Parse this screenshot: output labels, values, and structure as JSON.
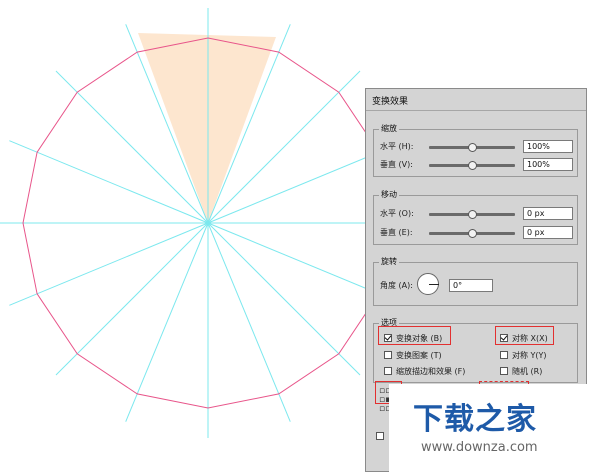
{
  "colors": {
    "guides": "#7ce8ee",
    "polygon": "#e8558a",
    "segment_fill": "#fde6cf",
    "panel_bg": "#d4d4d4",
    "highlight": "#e23030",
    "watermark_blue": "#1e5aa8"
  },
  "dialog": {
    "title": "变换效果",
    "scale": {
      "title": "缩放",
      "horizontal_label": "水平 (H):",
      "horizontal_value": "100%",
      "horizontal_slider_fraction": 0.5,
      "vertical_label": "垂直 (V):",
      "vertical_value": "100%",
      "vertical_slider_fraction": 0.5
    },
    "move": {
      "title": "移动",
      "horizontal_label": "水平 (O):",
      "horizontal_value": "0 px",
      "horizontal_slider_fraction": 0.5,
      "vertical_label": "垂直 (E):",
      "vertical_value": "0 px",
      "vertical_slider_fraction": 0.5
    },
    "rotate": {
      "title": "旋转",
      "angle_label": "角度 (A):",
      "angle_value": "0°"
    },
    "options": {
      "title": "选项",
      "transform_objects": {
        "label": "变换对象 (B)",
        "checked": true
      },
      "transform_patterns": {
        "label": "变换图案 (T)",
        "checked": false
      },
      "scale_strokes": {
        "label": "缩放描边和效果 (F)",
        "checked": false
      },
      "reflect_x": {
        "label": "对称 X(X)",
        "checked": true
      },
      "reflect_y": {
        "label": "对称 Y(Y)",
        "checked": false
      },
      "random": {
        "label": "随机 (R)",
        "checked": false
      }
    },
    "origin_icon": "reference-point-grid-icon"
  },
  "watermark": {
    "main": "下载之家",
    "sub": "www.downza.com"
  }
}
